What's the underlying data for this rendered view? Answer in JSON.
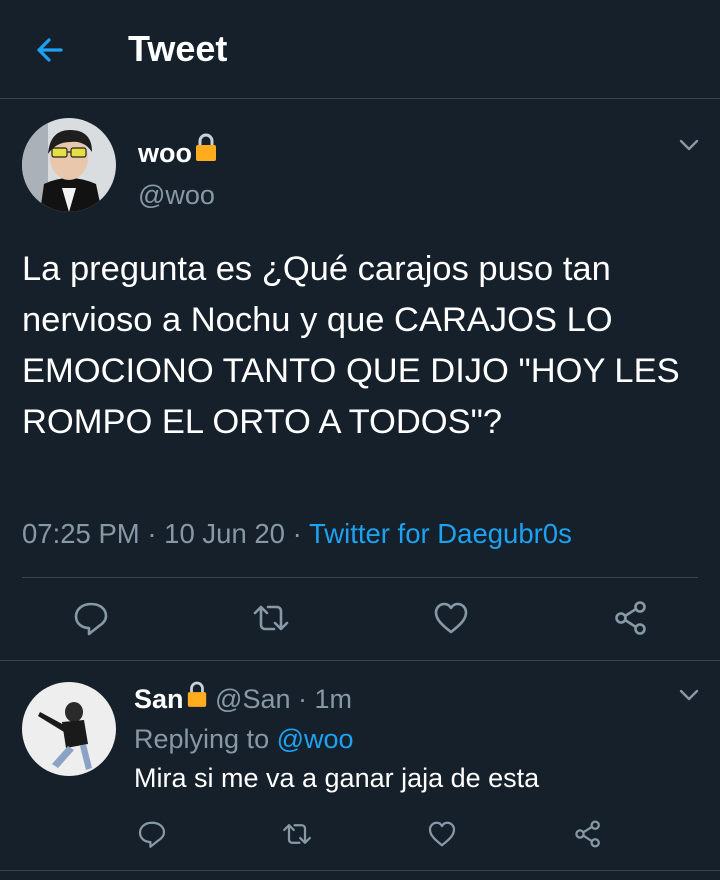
{
  "header": {
    "title": "Tweet"
  },
  "main_tweet": {
    "display_name": "woo",
    "handle": "@woo",
    "text": "La pregunta es ¿Qué carajos puso tan nervioso a Nochu y que CARAJOS LO EMOCIONO TANTO QUE DIJO \"HOY LES ROMPO EL ORTO A TODOS\"?",
    "time": "07:25 PM",
    "sep1": "·",
    "date": "10 Jun 20",
    "sep2": "·",
    "source": "Twitter for Daegubr0s"
  },
  "reply": {
    "display_name": "San",
    "handle": "@San",
    "sep": "·",
    "age": "1m",
    "replying_label": "Replying to",
    "replying_to": "@woo",
    "text": "Mira si me va a ganar jaja de esta"
  },
  "icons": {
    "back": "arrow-left-icon",
    "lock": "lock-icon",
    "more": "chevron-down-icon",
    "reply": "reply-icon",
    "retweet": "retweet-icon",
    "like": "heart-icon",
    "share": "share-icon"
  },
  "colors": {
    "background": "#15202b",
    "accent": "#1da1f2",
    "secondary_text": "#8899a6",
    "divider": "#38444d",
    "lock": "#ffad1f"
  }
}
